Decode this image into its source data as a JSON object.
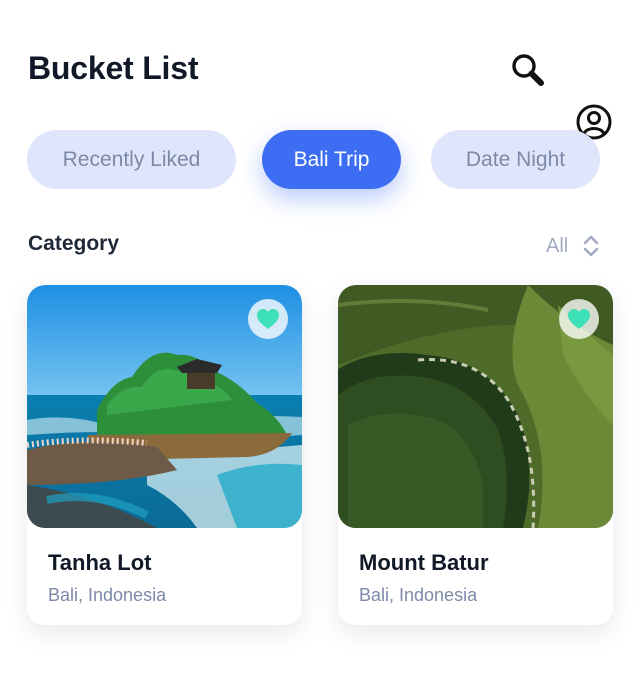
{
  "header": {
    "title": "Bucket List",
    "search_icon": "search-icon",
    "profile_icon": "user-circle-icon"
  },
  "tabs": [
    {
      "label": "Recently Liked",
      "active": false
    },
    {
      "label": "Bali Trip",
      "active": true
    },
    {
      "label": "Date Night",
      "active": false
    }
  ],
  "section": {
    "title": "Category",
    "filter_label": "All",
    "filter_icon": "sort-chevrons-icon"
  },
  "cards": [
    {
      "name": "Tanha Lot",
      "location": "Bali, Indonesia",
      "favorited": true,
      "image": "temple-on-rock-by-sea"
    },
    {
      "name": "Mount Batur",
      "location": "Bali, Indonesia",
      "favorited": true,
      "image": "aerial-volcano-crater"
    }
  ],
  "colors": {
    "accent": "#3d6df2",
    "pill_inactive_bg": "#dfe6fb",
    "pill_inactive_text": "#7d89a9",
    "heart": "#3ee0b8",
    "title_text": "#111827",
    "muted_text": "#7d89a9"
  }
}
